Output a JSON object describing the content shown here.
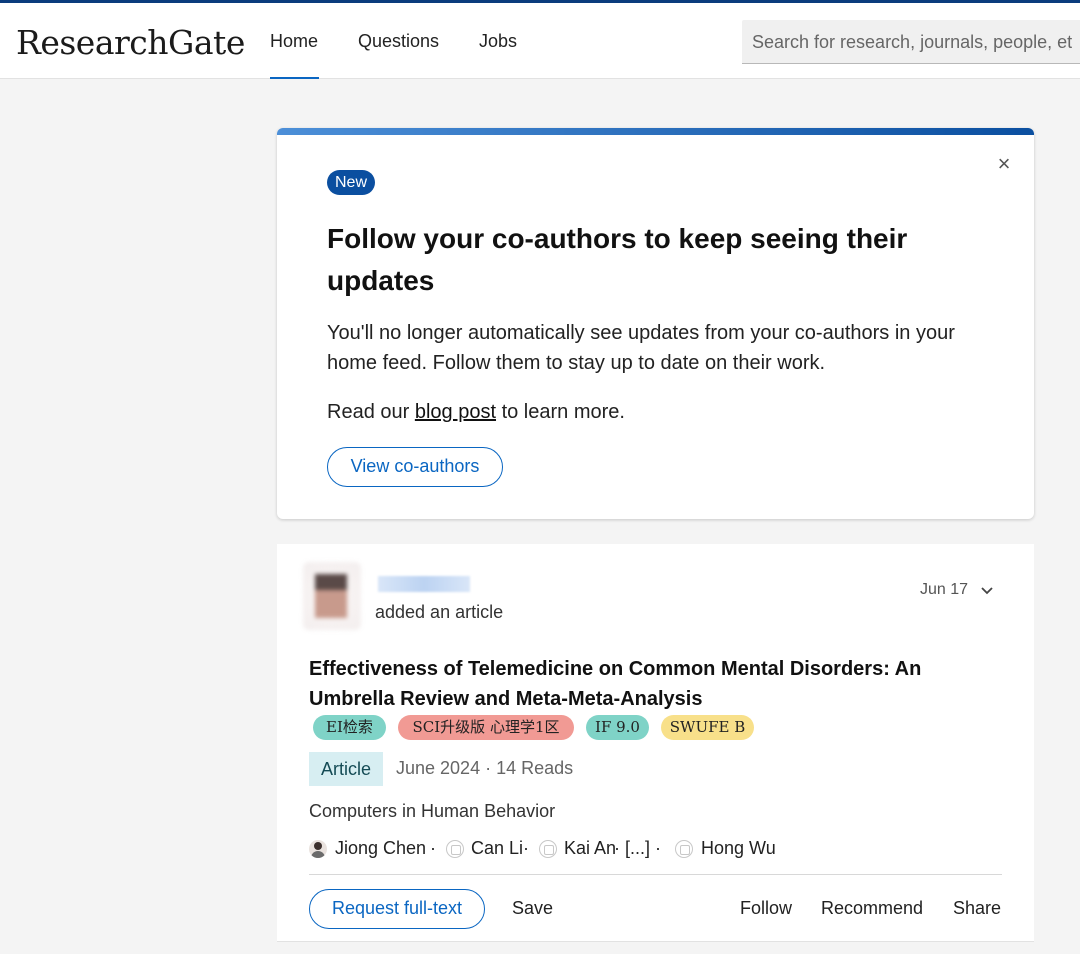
{
  "header": {
    "logo": "ResearchGate",
    "nav": {
      "home": "Home",
      "questions": "Questions",
      "jobs": "Jobs"
    },
    "search_placeholder": "Search for research, journals, people, et"
  },
  "promo": {
    "badge": "New",
    "title": "Follow your co-authors to keep seeing their updates",
    "body": "You'll no longer automatically see updates from your co-authors in your home feed. Follow them to stay up to date on their work.",
    "blog_prefix": "Read our ",
    "blog_link": "blog post",
    "blog_suffix": " to learn more.",
    "button": "View co-authors",
    "close_icon": "×"
  },
  "feed_item": {
    "action_text": "added an article",
    "date": "Jun 17",
    "title": "Effectiveness of Telemedicine on Common Mental Disorders: An Umbrella Review and Meta-Meta-Analysis",
    "tags": [
      {
        "label": "EI检索",
        "color": "#7fd3c7"
      },
      {
        "label": "SCI升级版 心理学1区",
        "color": "#f19a94"
      },
      {
        "label": "IF 9.0",
        "color": "#7fd3c7"
      },
      {
        "label": "SWUFE B",
        "color": "#f8e08a"
      }
    ],
    "type": "Article",
    "meta": "June 2024 · 14 Reads",
    "journal": "Computers in Human Behavior",
    "authors": [
      {
        "name": "Jiong Chen",
        "sep": " ·"
      },
      {
        "name": "Can Li",
        "sep": " ·"
      },
      {
        "name": "Kai An",
        "sep": " · [...] ·"
      },
      {
        "name": "Hong Wu",
        "sep": ""
      }
    ],
    "actions": {
      "request": "Request full-text",
      "save": "Save",
      "follow": "Follow",
      "recommend": "Recommend",
      "share": "Share"
    }
  }
}
